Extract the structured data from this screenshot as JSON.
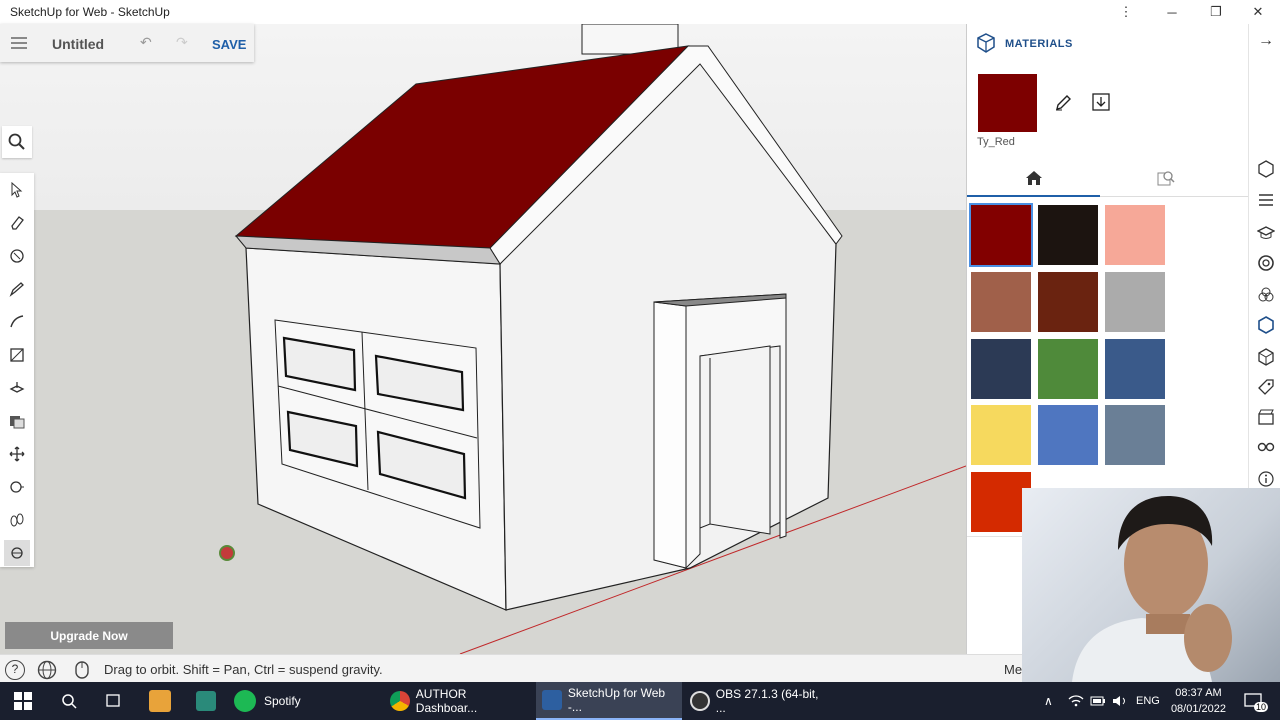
{
  "window": {
    "title": "SketchUp for Web - SketchUp"
  },
  "topbar": {
    "doc_title": "Untitled",
    "save_label": "SAVE"
  },
  "status": {
    "message": "Drag to orbit. Shift = Pan, Ctrl = suspend gravity.",
    "right_fragment": "Me"
  },
  "upgrade": {
    "label": "Upgrade Now"
  },
  "materials": {
    "header": "MATERIALS",
    "current": {
      "name": "Ty_Red",
      "color": "#7d0000"
    },
    "swatches": [
      "#820000",
      "#1c1410",
      "#f6a898",
      "#a0604a",
      "#6a2310",
      "#ababab",
      "#2c3a55",
      "#4f8a3a",
      "#3a5a8a",
      "#f6d95e",
      "#4f76c0",
      "#6a7f96",
      "#d42a00"
    ]
  },
  "scene": {
    "roof_color": "#7a0000",
    "wall_color": "#f5f5f5",
    "ground_color": "#d6d6d2",
    "axis_color": "#c0282a"
  },
  "taskbar": {
    "apps": [
      {
        "label": "Spotify"
      },
      {
        "label": "AUTHOR Dashboar..."
      },
      {
        "label": "SketchUp for Web -..."
      },
      {
        "label": "OBS 27.1.3 (64-bit, ..."
      }
    ],
    "lang": "ENG",
    "time": "08:37 AM",
    "date": "08/01/2022",
    "notifications": "10"
  }
}
